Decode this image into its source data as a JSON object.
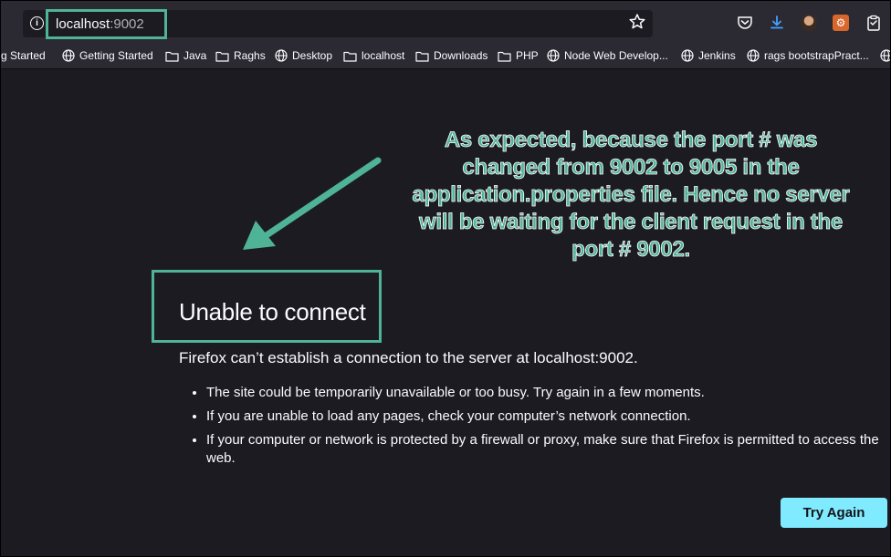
{
  "urlbar": {
    "host": "localhost",
    "port": ":9002"
  },
  "icons": {
    "info": "info-icon",
    "star": "star-icon",
    "pocket": "pocket-icon",
    "downloads": "download-icon",
    "account": "avatar",
    "extension": "extension-icon",
    "clipboard": "clipboard-icon"
  },
  "bookmarks": [
    {
      "label": "g Started",
      "icon": "none"
    },
    {
      "label": "Getting Started",
      "icon": "globe-icon"
    },
    {
      "label": "Java",
      "icon": "folder-icon"
    },
    {
      "label": "Raghs",
      "icon": "folder-icon"
    },
    {
      "label": "Desktop",
      "icon": "globe-icon"
    },
    {
      "label": "localhost",
      "icon": "folder-icon"
    },
    {
      "label": "Downloads",
      "icon": "folder-icon"
    },
    {
      "label": "PHP",
      "icon": "folder-icon"
    },
    {
      "label": "Node Web Develop...",
      "icon": "globe-icon"
    },
    {
      "label": "Jenkins",
      "icon": "globe-icon"
    },
    {
      "label": "rags bootstrapPract...",
      "icon": "globe-icon"
    },
    {
      "label": "",
      "icon": "globe-icon"
    }
  ],
  "annotation": {
    "text": "As expected, because the port # was changed from 9002 to 9005 in the application.properties file. Hence no server will be waiting for the client request in the port # 9002."
  },
  "error": {
    "title": "Unable to connect",
    "description": "Firefox can’t establish a connection to the server at localhost:9002.",
    "bullets": [
      "The site could be temporarily unavailable or too busy. Try again in a few moments.",
      "If you are unable to load any pages, check your computer’s network connection.",
      "If your computer or network is protected by a firewall or proxy, make sure that Firefox is permitted to access the web."
    ],
    "button_label": "Try Again"
  },
  "colors": {
    "annotation": "#4fb396",
    "page_bg": "#1c1b22",
    "toolbar_bg": "#2b2a33",
    "button_bg": "#80ebff"
  }
}
